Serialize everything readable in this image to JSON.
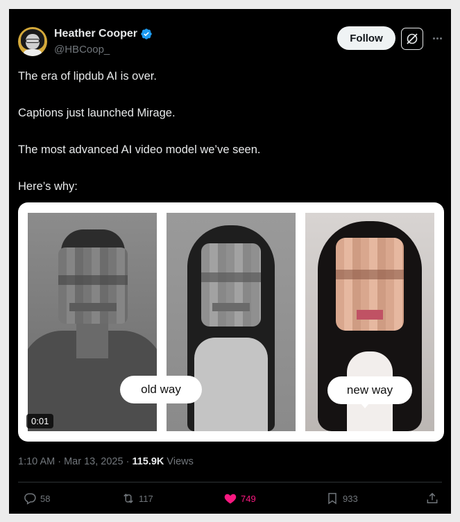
{
  "author": {
    "name": "Heather Cooper",
    "handle": "@HBCoop_",
    "verified_color": "#1d9bf0"
  },
  "header": {
    "follow_label": "Follow",
    "grok_icon": "grok-icon",
    "more_icon": "more-dots-icon"
  },
  "tweet": {
    "lines": [
      "The era of lipdub AI is over.",
      "Captions just launched Mirage.",
      "The most advanced AI video model we’ve seen.",
      "Here’s why:"
    ]
  },
  "media": {
    "pill_old": "old way",
    "pill_new": "new way",
    "timer": "0:01"
  },
  "meta": {
    "time": "1:10 AM",
    "separator": " · ",
    "date": "Mar 13, 2025",
    "views_count": "115.9K",
    "views_label": " Views"
  },
  "actions": {
    "replies": "58",
    "reposts": "117",
    "likes": "749",
    "bookmarks": "933",
    "like_color": "#f91880"
  }
}
